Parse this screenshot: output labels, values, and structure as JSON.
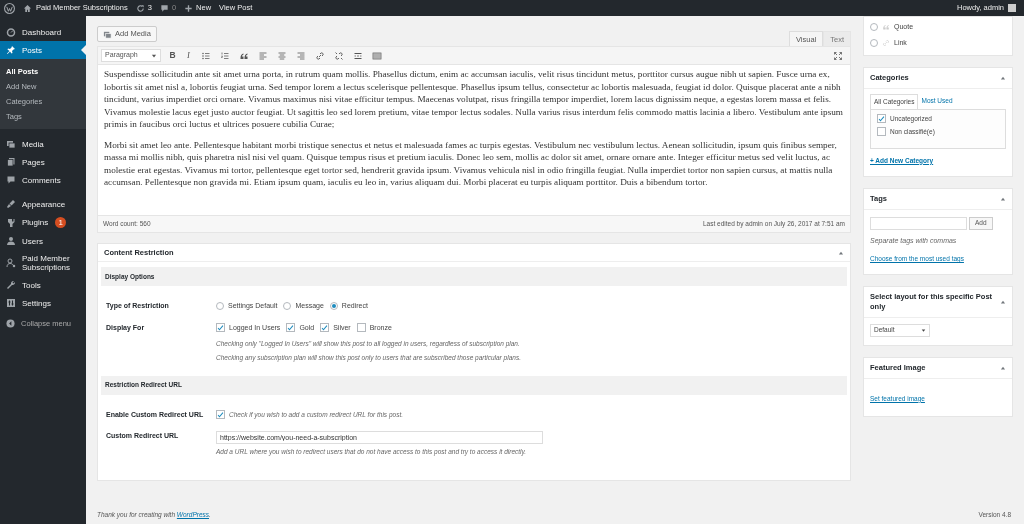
{
  "admin_bar": {
    "site_name": "Paid Member Subscriptions",
    "updates": "3",
    "comments": "0",
    "new": "New",
    "view_post": "View Post",
    "greeting": "Howdy, admin"
  },
  "sidebar": {
    "items": [
      {
        "label": "Dashboard",
        "selected": false
      },
      {
        "label": "Posts",
        "selected": true,
        "expanded": true,
        "children": [
          {
            "label": "All Posts",
            "selected": true
          },
          {
            "label": "Add New",
            "selected": false
          },
          {
            "label": "Categories",
            "selected": false
          },
          {
            "label": "Tags",
            "selected": false
          }
        ]
      },
      {
        "label": "Media",
        "selected": false
      },
      {
        "label": "Pages",
        "selected": false
      },
      {
        "label": "Comments",
        "selected": false
      },
      {
        "label": "Appearance",
        "selected": false
      },
      {
        "label": "Plugins",
        "selected": false,
        "badge": "1"
      },
      {
        "label": "Users",
        "selected": false
      },
      {
        "label": "Paid Member Subscriptions",
        "selected": false
      },
      {
        "label": "Tools",
        "selected": false
      },
      {
        "label": "Settings",
        "selected": false
      }
    ],
    "collapse": "Collapse menu"
  },
  "editor": {
    "add_media": "Add Media",
    "tabs": [
      {
        "label": "Visual",
        "selected": true
      },
      {
        "label": "Text",
        "selected": false
      }
    ],
    "format": "Paragraph",
    "bold": "B",
    "italic": "I",
    "paragraphs": [
      "Suspendisse sollicitudin ante sit amet urna porta, in rutrum quam mollis. Phasellus dictum, enim ac accumsan iaculis, velit risus tincidunt metus, porttitor cursus augue nibh ut sapien. Fusce urna ex, lobortis sit amet nisl a, lobortis feugiat urna. Sed tempor lorem a lectus scelerisque pellentesque. Phasellus ipsum tellus, consectetur ac lobortis malesuada, feugiat id dolor. Quisque placerat ante a nibh tincidunt, varius imperdiet orci ornare. Vivamus maximus nisi vitae efficitur tempus. Maecenas volutpat, risus fringilla tempor imperdiet, lorem lacus dignissim neque, a egestas lorem massa et felis. Vivamus molestie lacus eget justo auctor feugiat. Ut sagittis leo sed lorem pretium, vitae tempor lectus sodales. Nulla varius risus interdum felis commodo mattis lacinia a libero. Vestibulum ante ipsum primis in faucibus orci luctus et ultrices posuere cubilia Curae;",
      "Morbi sit amet leo ante. Pellentesque habitant morbi tristique senectus et netus et malesuada fames ac turpis egestas. Vestibulum nec vestibulum lectus. Aenean sollicitudin, ipsum quis finibus semper, massa mi mollis nibh, quis pharetra nisl nisi vel quam. Quisque tempus risus et pretium iaculis. Donec leo sem, mollis ac dolor sit amet, ornare ornare ante. Integer efficitur metus sed velit luctus, ac molestie erat egestas. Vivamus mi tortor, pellentesque eget tortor sed, hendrerit gravida ipsum. Vivamus vehicula nisl in odio fringilla feugiat. Nulla imperdiet tortor non sapien cursus, at mattis nulla accumsan. Pellentesque non gravida mi. Etiam ipsum quam, iaculis eu leo in, varius aliquam dui. Morbi placerat eu turpis aliquam porttitor. Duis a bibendum tortor."
    ],
    "word_count": "Word count: 560",
    "last_edited": "Last edited by admin on July 26, 2017 at 7:51 am"
  },
  "content_restriction": {
    "title": "Content Restriction",
    "display_heading": "Display Options",
    "type_label": "Type of Restriction",
    "type_options": [
      {
        "label": "Settings Default",
        "selected": false
      },
      {
        "label": "Message",
        "selected": false
      },
      {
        "label": "Redirect",
        "selected": true
      }
    ],
    "display_for_label": "Display For",
    "display_for_options": [
      {
        "label": "Logged In Users",
        "checked": true
      },
      {
        "label": "Gold",
        "checked": true
      },
      {
        "label": "Silver",
        "checked": true
      },
      {
        "label": "Bronze",
        "checked": false
      }
    ],
    "notes": [
      "Checking only \"Logged In Users\" will show this post to all logged in users, regardless of subscription plan.",
      "Checking any subscription plan will show this post only to users that are subscribed those particular plans."
    ],
    "redirect_heading": "Restriction Redirect URL",
    "enable_label": "Enable Custom Redirect URL",
    "enable_checked": true,
    "enable_note": "Check if you wish to add a custom redirect URL for this post.",
    "url_label": "Custom Redirect URL",
    "url_value": "https://website.com/you-need-a-subscription",
    "url_note": "Add a URL where you wish to redirect users that do not have access to this post and try to access it directly."
  },
  "format_box": {
    "options": [
      {
        "label": "Quote",
        "selected": false
      },
      {
        "label": "Link",
        "selected": false
      }
    ]
  },
  "categories": {
    "title": "Categories",
    "tabs": [
      {
        "label": "All Categories",
        "selected": true
      },
      {
        "label": "Most Used",
        "selected": false
      }
    ],
    "items": [
      {
        "label": "Uncategorized",
        "checked": true
      },
      {
        "label": "Non classifié(e)",
        "checked": false
      }
    ],
    "add_link": "+ Add New Category"
  },
  "tags": {
    "title": "Tags",
    "add_button": "Add",
    "hint": "Separate tags with commas",
    "link": "Choose from the most used tags"
  },
  "layout_box": {
    "title": "Select layout for this specific Post only",
    "value": "Default"
  },
  "featured_image": {
    "title": "Featured Image",
    "link": "Set featured image"
  },
  "footer": {
    "thanks": "Thank you for creating with ",
    "link": "WordPress",
    "end": ".",
    "version": "Version 4.8"
  }
}
